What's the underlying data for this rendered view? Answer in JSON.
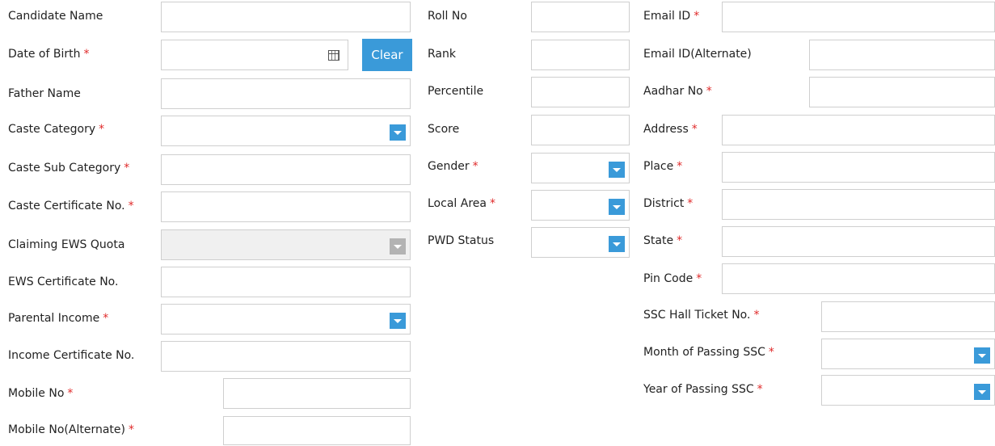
{
  "left": {
    "candidate_name": {
      "label": "Candidate Name",
      "required": ""
    },
    "dob": {
      "label": "Date of Birth",
      "required": "*",
      "clear_label": "Clear"
    },
    "father_name": {
      "label": "Father Name",
      "required": ""
    },
    "caste_category": {
      "label": "Caste Category",
      "required": "*"
    },
    "caste_sub_category": {
      "label": "Caste Sub Category",
      "required": "*"
    },
    "caste_certificate": {
      "label": "Caste Certificate No.",
      "required": "*"
    },
    "claiming_ews": {
      "label": "Claiming EWS Quota",
      "required": ""
    },
    "ews_certificate": {
      "label": "EWS Certificate No.",
      "required": ""
    },
    "parental_income": {
      "label": "Parental Income",
      "required": "*"
    },
    "income_certificate": {
      "label": "Income Certificate No.",
      "required": ""
    },
    "mobile": {
      "label": "Mobile No",
      "required": "*"
    },
    "mobile_alt": {
      "label": "Mobile No(Alternate)",
      "required": "*"
    }
  },
  "middle": {
    "roll_no": {
      "label": "Roll No",
      "required": ""
    },
    "rank": {
      "label": "Rank",
      "required": ""
    },
    "percentile": {
      "label": "Percentile",
      "required": ""
    },
    "score": {
      "label": "Score",
      "required": ""
    },
    "gender": {
      "label": "Gender",
      "required": "*"
    },
    "local_area": {
      "label": "Local Area",
      "required": "*"
    },
    "pwd_status": {
      "label": "PWD Status",
      "required": ""
    }
  },
  "right": {
    "email": {
      "label": "Email ID",
      "required": "*"
    },
    "email_alt": {
      "label": "Email ID(Alternate)",
      "required": ""
    },
    "aadhar": {
      "label": "Aadhar No",
      "required": "*"
    },
    "address": {
      "label": "Address",
      "required": "*"
    },
    "place": {
      "label": "Place",
      "required": "*"
    },
    "district": {
      "label": "District",
      "required": "*"
    },
    "state": {
      "label": "State",
      "required": "*"
    },
    "pin_code": {
      "label": "Pin Code",
      "required": "*"
    },
    "ssc_hall_ticket": {
      "label": "SSC Hall Ticket No.",
      "required": "*"
    },
    "month_ssc": {
      "label": "Month of Passing SSC",
      "required": "*"
    },
    "year_ssc": {
      "label": "Year of Passing SSC",
      "required": "*"
    }
  },
  "icons": {
    "calendar": "calendar-icon",
    "dropdown": "chevron-down-icon"
  },
  "colors": {
    "accent": "#3a9ad9",
    "required": "#e02a2a",
    "border": "#cfcfcf"
  }
}
